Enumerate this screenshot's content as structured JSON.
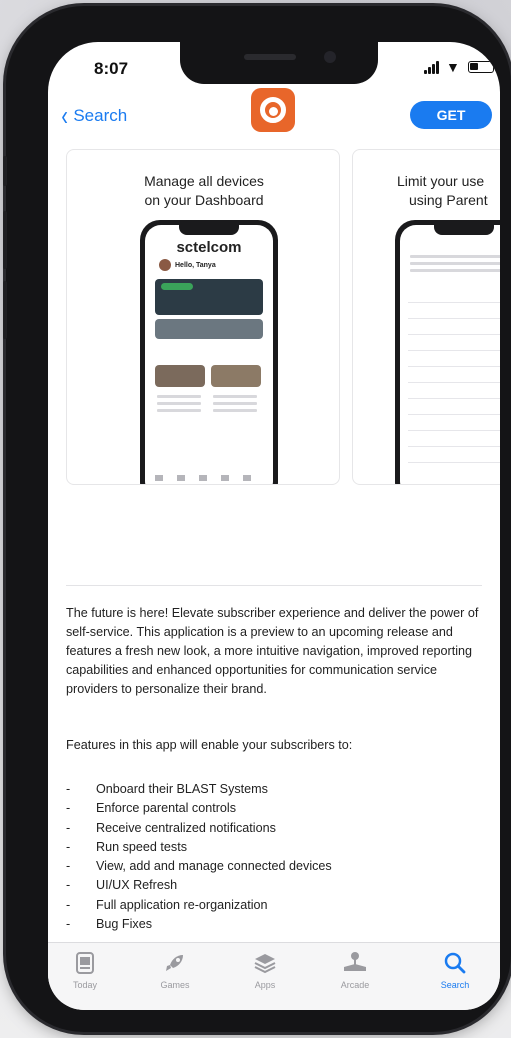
{
  "status_bar": {
    "time": "8:07"
  },
  "nav": {
    "back_label": "Search",
    "get_label": "GET"
  },
  "screenshots": [
    {
      "title_line1": "Manage all devices",
      "title_line2": "on your Dashboard",
      "brand": "sctelcom",
      "greeting": "Hello, Tanya"
    },
    {
      "title_line1": "Limit your use",
      "title_line2": "using Parent"
    }
  ],
  "description": "The future is here! Elevate subscriber experience and deliver the power of self-service. This application is a preview to an upcoming release and features a fresh new look, a more intuitive navigation, improved reporting capabilities and enhanced opportunities for communication service providers to personalize their brand.",
  "features_intro": "Features in this app will enable your subscribers to:",
  "features": [
    "Onboard their BLAST Systems",
    "Enforce parental controls",
    "Receive centralized notifications",
    "Run speed tests",
    "View, add and manage connected devices",
    "UI/UX Refresh",
    "Full application re-organization",
    "Bug Fixes"
  ],
  "bullet": "-",
  "tabs": [
    {
      "label": "Today",
      "icon": "today-icon"
    },
    {
      "label": "Games",
      "icon": "rocket-icon"
    },
    {
      "label": "Apps",
      "icon": "layers-icon"
    },
    {
      "label": "Arcade",
      "icon": "joystick-icon"
    },
    {
      "label": "Search",
      "icon": "search-icon",
      "active": true
    }
  ],
  "colors": {
    "accent": "#1a7bf0",
    "app_icon": "#e8662a"
  }
}
